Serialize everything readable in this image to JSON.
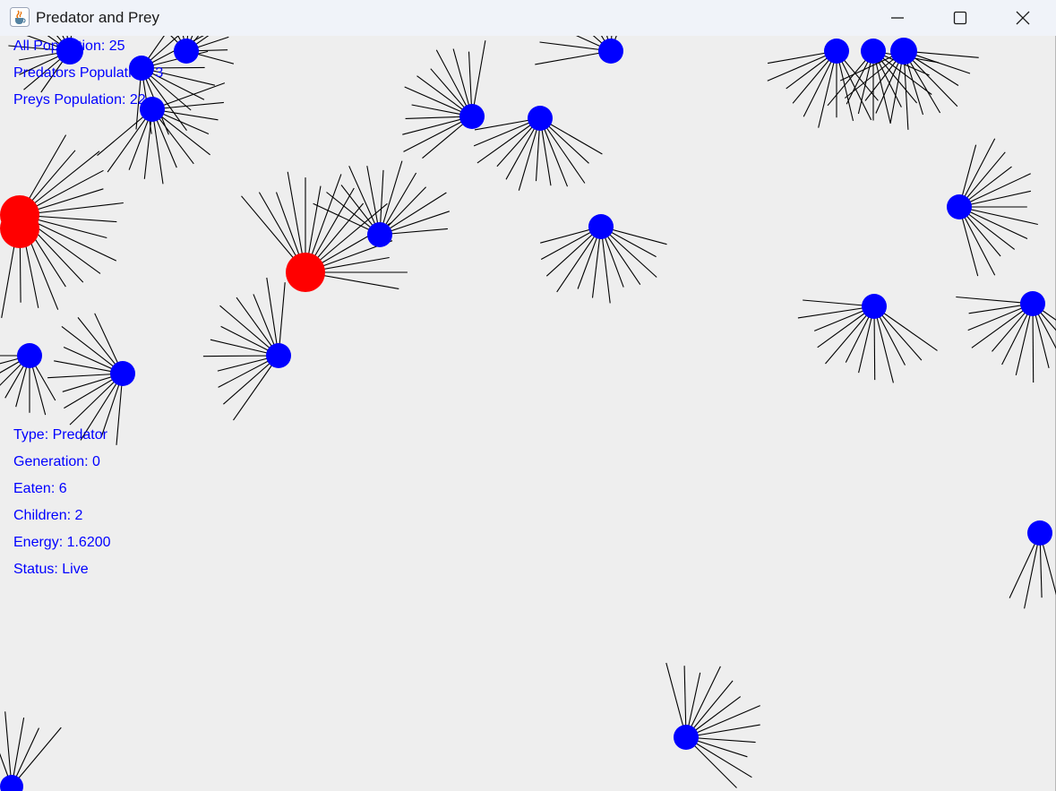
{
  "window": {
    "title": "Predator and Prey",
    "app_icon": "java-cup-icon"
  },
  "window_controls": {
    "minimize_icon": "minimize-icon",
    "maximize_icon": "maximize-icon",
    "close_icon": "close-icon"
  },
  "stats": {
    "all_population": "All Population: 25",
    "predators_population": "Predators Population: 3",
    "preys_population": "Preys Population: 22"
  },
  "selected_agent": {
    "type": "Type: Predator",
    "generation": "Generation: 0",
    "eaten": "Eaten: 6",
    "children": "Children: 2",
    "energy": "Energy: 1.6200",
    "status": "Status: Live"
  },
  "colors": {
    "predator": "#ff0000",
    "prey": "#0000ff",
    "sensor": "#000000",
    "text": "#0000ff",
    "background": "#eeeeee"
  }
}
